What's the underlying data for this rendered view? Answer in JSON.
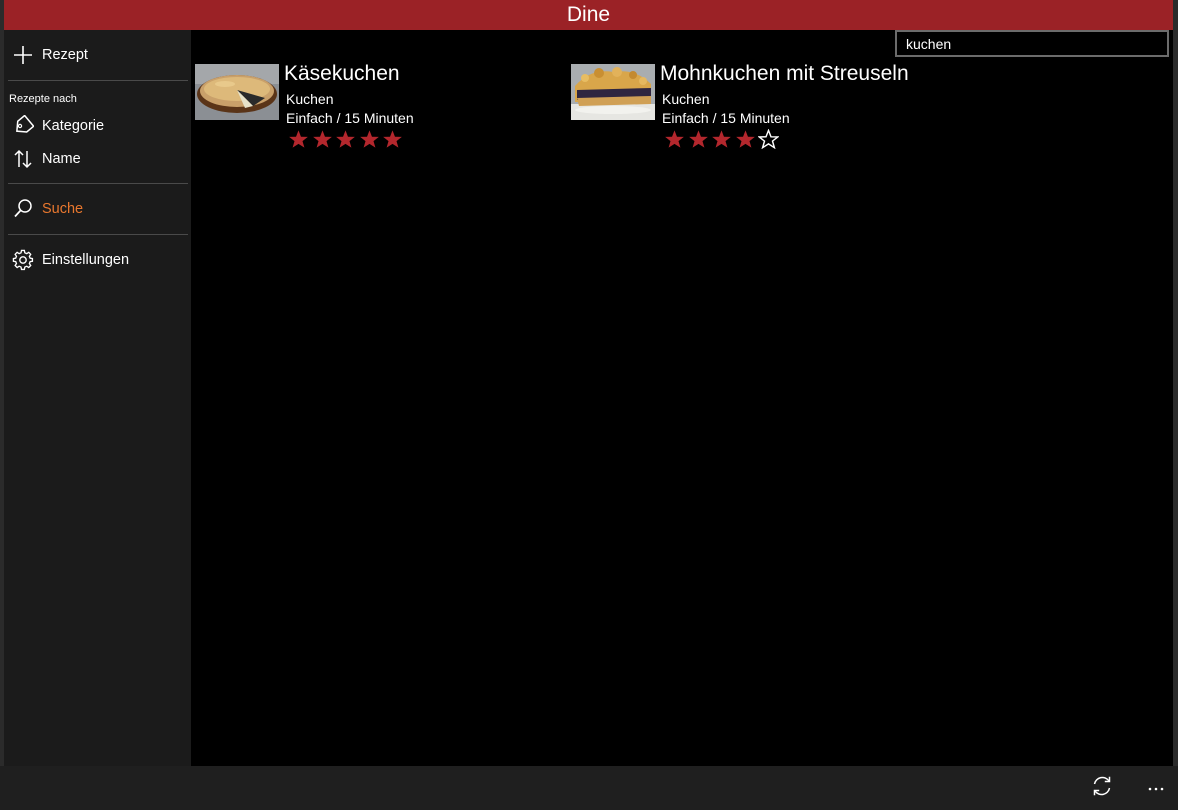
{
  "app": {
    "title": "Dine"
  },
  "colors": {
    "accent": "#9b2226",
    "active_nav": "#e8772e",
    "star_filled": "#b3272d",
    "star_empty": "#ffffff"
  },
  "sidebar": {
    "new_recipe_label": "Rezept",
    "section_label": "Rezepte nach",
    "items": [
      {
        "label": "Kategorie",
        "icon": "tag-icon"
      },
      {
        "label": "Name",
        "icon": "sort-icon"
      },
      {
        "label": "Suche",
        "icon": "search-icon",
        "active": true
      },
      {
        "label": "Einstellungen",
        "icon": "gear-icon"
      }
    ]
  },
  "search": {
    "value": "kuchen"
  },
  "results": [
    {
      "title": "Käsekuchen",
      "category": "Kuchen",
      "meta": "Einfach / 15 Minuten",
      "rating": 5,
      "max_rating": 5,
      "image": "cheesecake-thumbnail"
    },
    {
      "title": "Mohnkuchen mit Streuseln",
      "category": "Kuchen",
      "meta": "Einfach / 15 Minuten",
      "rating": 4,
      "max_rating": 5,
      "image": "poppyseed-crumble-cake-thumbnail"
    }
  ],
  "appbar": {
    "buttons": [
      {
        "icon": "sync-icon"
      },
      {
        "icon": "more-icon"
      }
    ]
  }
}
